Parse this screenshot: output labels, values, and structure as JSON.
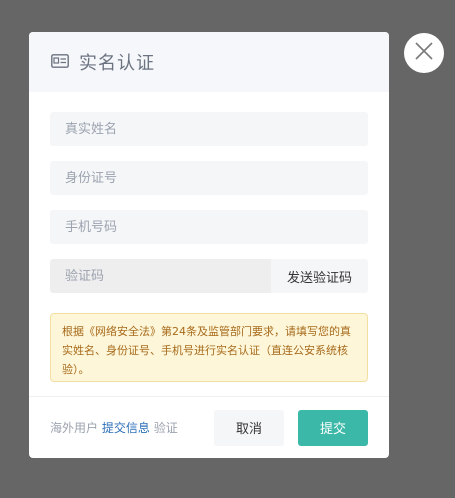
{
  "modal": {
    "title": "实名认证",
    "icon": "id-card-icon"
  },
  "form": {
    "name_placeholder": "真实姓名",
    "id_placeholder": "身份证号",
    "phone_placeholder": "手机号码",
    "code_placeholder": "验证码",
    "send_code_label": "发送验证码"
  },
  "notice": {
    "text": "根据《网络安全法》第24条及监管部门要求，请填写您的真实姓名、身份证号、手机号进行实名认证（直连公安系统核验）。"
  },
  "footer": {
    "overseas_prefix": "海外用户",
    "overseas_link": "提交信息",
    "overseas_suffix": "验证",
    "cancel_label": "取消",
    "submit_label": "提交"
  },
  "colors": {
    "overlay": "#666666",
    "accent": "#3bb8a7",
    "notice_bg": "#fdf6d8",
    "notice_text": "#a76a1b",
    "link": "#2c6fb8"
  }
}
